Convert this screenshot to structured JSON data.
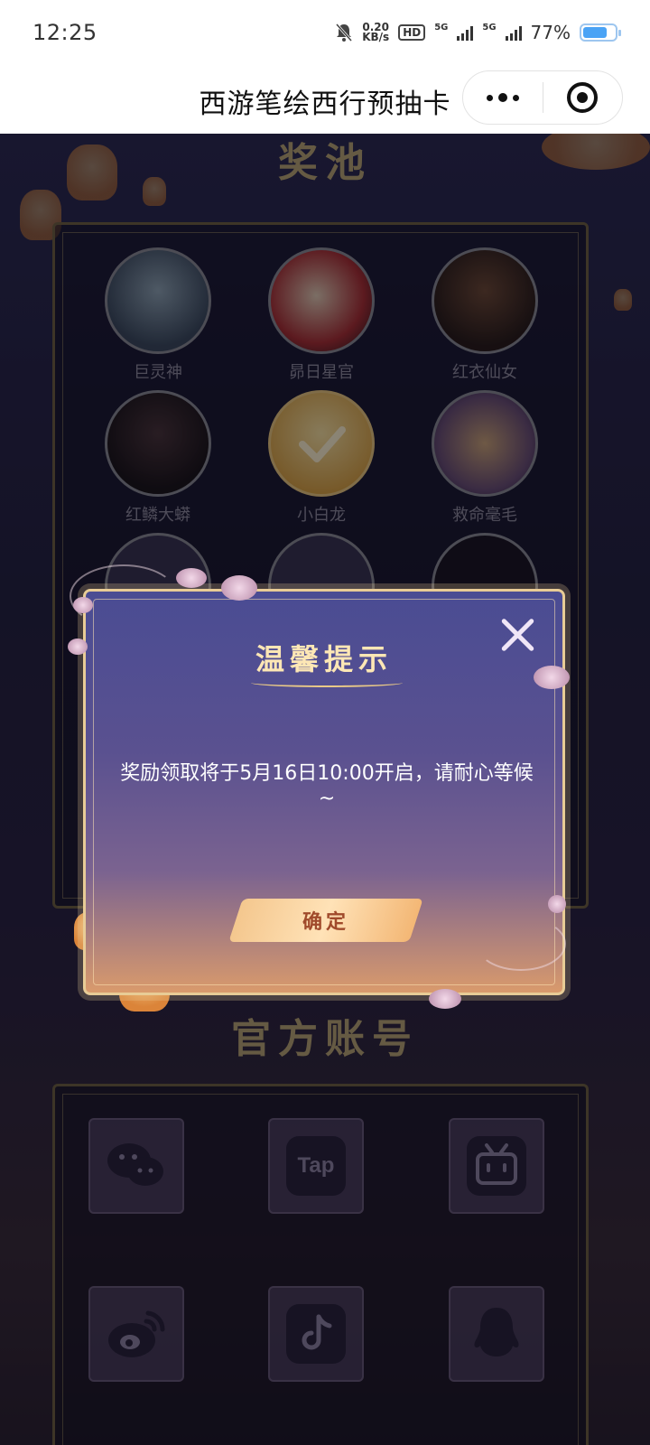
{
  "status_bar": {
    "time": "12:25",
    "net_speed_value": "0.20",
    "net_speed_unit": "KB/s",
    "hd_label": "HD",
    "sim1_label": "5G",
    "sim2_label": "5G",
    "battery_percent": "77%",
    "battery_level": 0.77,
    "icons": [
      "mute-bell-icon",
      "hd-icon",
      "signal-icon",
      "battery-icon"
    ]
  },
  "titlebar": {
    "title": "西游笔绘西行预抽卡",
    "menu_icon": "more-dots-icon",
    "close_icon": "target-circle-icon"
  },
  "pool": {
    "section_title": "奖池",
    "items": [
      {
        "name": "巨灵神"
      },
      {
        "name": "昴日星官"
      },
      {
        "name": "红衣仙女"
      },
      {
        "name": "红鳞大蟒"
      },
      {
        "name": "小白龙"
      },
      {
        "name": "救命毫毛"
      }
    ]
  },
  "modal": {
    "title": "温馨提示",
    "message": "奖励领取将于5月16日10:00开启，请耐心等候~",
    "confirm_label": "确定",
    "close_icon": "close-x-icon"
  },
  "accounts": {
    "section_title": "官方账号",
    "items": [
      {
        "icon": "wechat-icon"
      },
      {
        "icon": "taptap-icon",
        "text": "Tap"
      },
      {
        "icon": "bilibili-icon"
      },
      {
        "icon": "weibo-icon"
      },
      {
        "icon": "douyin-icon"
      },
      {
        "icon": "qq-icon"
      }
    ]
  },
  "colors": {
    "gold": "#e8cc96",
    "confirm_text": "#a04a2b",
    "battery": "#4aa3f5"
  }
}
